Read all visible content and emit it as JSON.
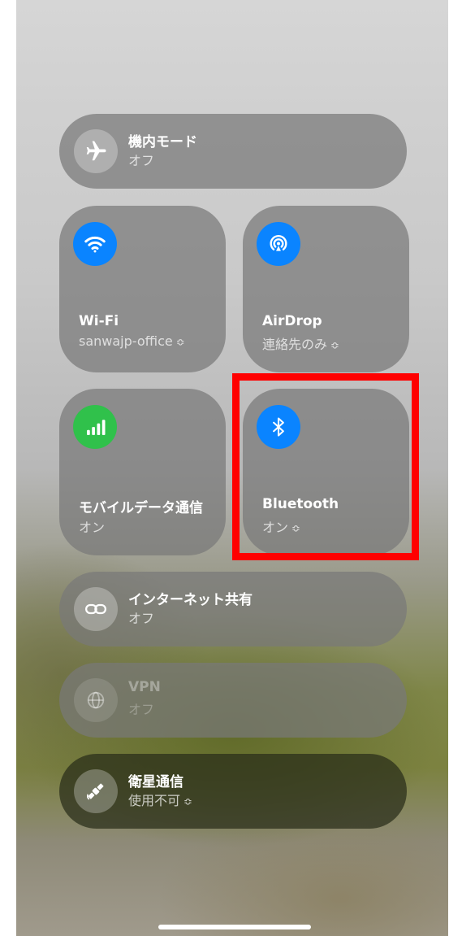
{
  "tiles": {
    "airplane": {
      "title": "機内モード",
      "subtitle": "オフ",
      "icon": "airplane-icon"
    },
    "wifi": {
      "title": "Wi-Fi",
      "subtitle": "sanwajp-office",
      "icon": "wifi-icon"
    },
    "airdrop": {
      "title": "AirDrop",
      "subtitle": "連絡先のみ",
      "icon": "airdrop-icon"
    },
    "cellular": {
      "title": "モバイルデータ通信",
      "subtitle": "オン",
      "icon": "cellular-signal-icon"
    },
    "bluetooth": {
      "title": "Bluetooth",
      "subtitle": "オン",
      "icon": "bluetooth-icon"
    },
    "hotspot": {
      "title": "インターネット共有",
      "subtitle": "オフ",
      "icon": "link-icon"
    },
    "vpn": {
      "title": "VPN",
      "subtitle": "オフ",
      "icon": "globe-icon"
    },
    "satellite": {
      "title": "衛星通信",
      "subtitle": "使用不可",
      "icon": "satellite-icon"
    }
  },
  "chevron_glyph": "≎",
  "colors": {
    "accent_blue": "#0a84ff",
    "cellular_green": "#30c14b",
    "highlight_red": "#ff0000"
  }
}
